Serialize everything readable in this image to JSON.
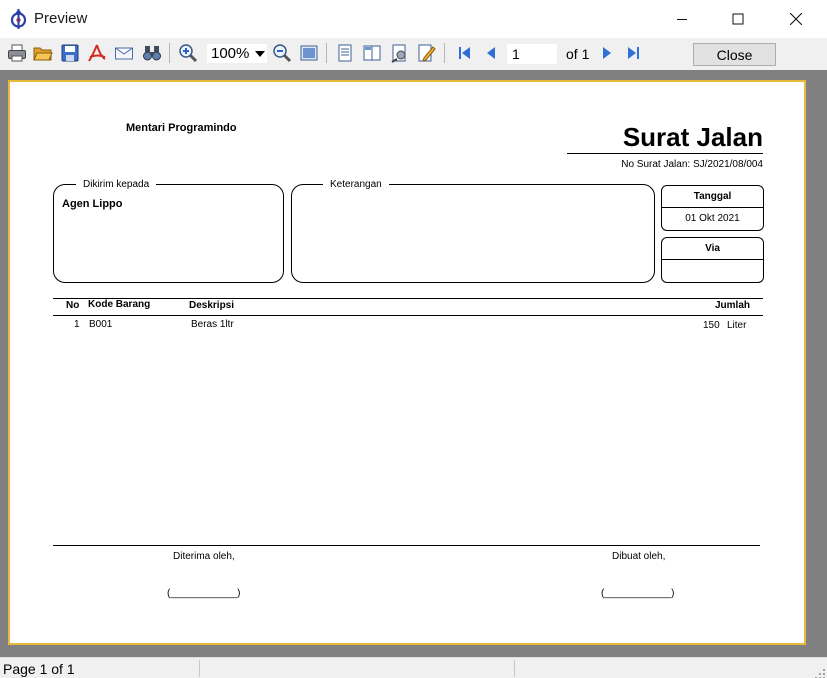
{
  "window": {
    "title": "Preview",
    "app_icon": "preview-app-icon"
  },
  "toolbar": {
    "icons": [
      "print-icon",
      "open-icon",
      "save-icon",
      "pdf-export-icon",
      "email-icon",
      "find-icon",
      "zoom-in-icon",
      "zoom-out-icon",
      "page-width-icon",
      "single-page-icon",
      "two-pages-icon",
      "page-setup-icon",
      "edit-icon",
      "first-page-icon",
      "previous-page-icon",
      "next-page-icon",
      "last-page-icon"
    ],
    "zoom_value": "100%",
    "page_value": "1",
    "page_of": "of 1",
    "close_label": "Close"
  },
  "document": {
    "company": "Mentari Programindo",
    "title": "Surat Jalan",
    "doc_no": "No Surat Jalan: SJ/2021/08/004",
    "dikirim_label": "Dikirim kepada",
    "recipient": "Agen Lippo",
    "keterangan_label": "Keterangan",
    "keterangan_value": "",
    "tanggal_label": "Tanggal",
    "tanggal_value": "01 Okt 2021",
    "via_label": "Via",
    "via_value": "",
    "table": {
      "headers": {
        "no": "No",
        "kode": "Kode Barang",
        "deskripsi": "Deskripsi",
        "jumlah": "Jumlah"
      },
      "rows": [
        {
          "no": "1",
          "kode": "B001",
          "deskripsi": "Beras 1ltr",
          "qty": "150",
          "unit": "Liter"
        }
      ]
    },
    "received_by": "Diterima oleh,",
    "made_by": "Dibuat oleh,",
    "signature_line": "(____________)"
  },
  "status": {
    "page_text": "Page 1 of 1"
  },
  "colors": {
    "preview_bg": "#808080",
    "paper_border": "#e8b93c",
    "toolbar_bg": "#f0f0f0",
    "nav_arrow": "#2f6fd6"
  }
}
